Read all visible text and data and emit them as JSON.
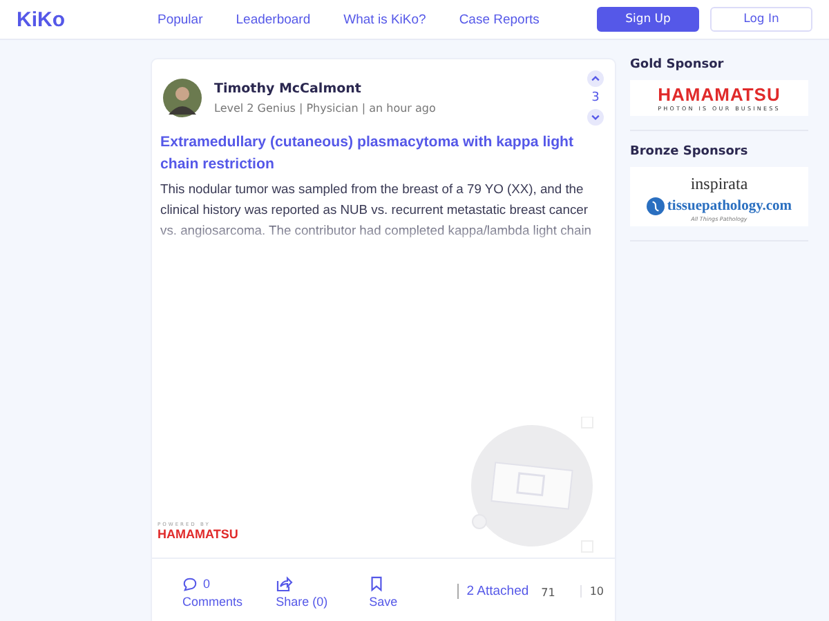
{
  "header": {
    "logo": "KiKo",
    "nav": [
      "Popular",
      "Leaderboard",
      "What is KiKo?",
      "Case Reports"
    ],
    "buttons": [
      {
        "label": "Sign Up",
        "kind": "primary"
      },
      {
        "label": "Log In",
        "kind": "outline"
      }
    ]
  },
  "post": {
    "author": "Timothy McCalmont",
    "meta": "Level 2 Genius | Physician | an hour ago",
    "votes": "3",
    "title": "Extramedullary (cutaneous) plasmacytoma with kappa light chain restriction",
    "body": "This nodular tumor was sampled from the breast of a 79 YO (XX), and the clinical history was reported as NUB vs. recurrent metastatic breast cancer vs. angiosarcoma. The contributor had completed kappa/lambda light chain",
    "viewer": {
      "powered_by": "POWERED BY",
      "brand": "HAMAMATSU"
    },
    "actions": [
      {
        "kind": "comments",
        "count": "0",
        "label": "Comments"
      },
      {
        "kind": "share",
        "label": "Share (0)"
      },
      {
        "kind": "save",
        "label": "Save"
      }
    ],
    "attached": "2 Attached",
    "stat_1": "71",
    "stat_2": "10"
  },
  "sidebar": [
    {
      "heading": "Gold Sponsor",
      "logos": [
        {
          "kind": "hamamatsu",
          "name": "HAMAMATSU",
          "tagline": "PHOTON IS OUR BUSINESS"
        }
      ]
    },
    {
      "heading": "Bronze Sponsors",
      "logos": [
        {
          "kind": "inspirata",
          "name": "inspirata"
        },
        {
          "kind": "tissuepathology",
          "name": "tissuepathology.com",
          "tagline": "All Things Pathology"
        }
      ]
    }
  ]
}
